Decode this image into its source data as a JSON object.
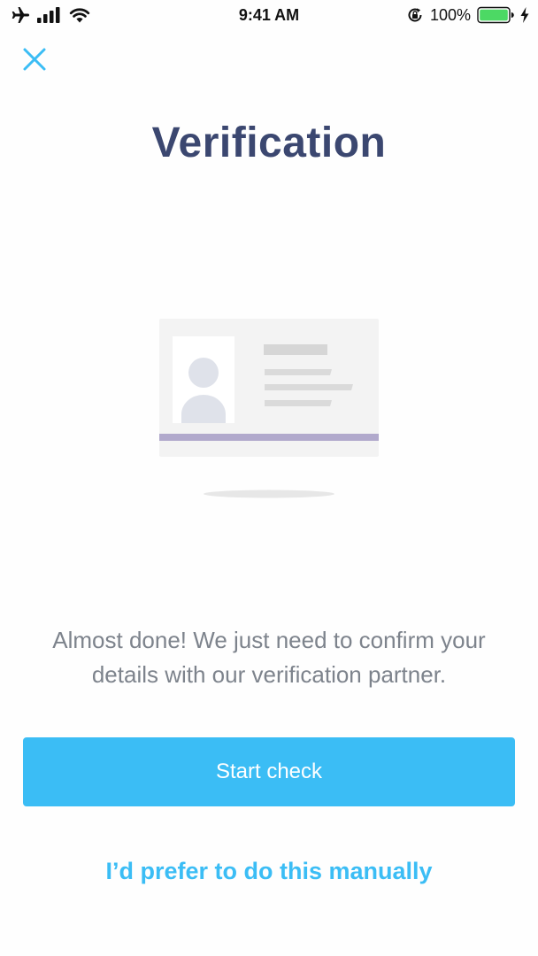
{
  "status_bar": {
    "time": "9:41 AM",
    "battery_percent": "100%",
    "icons": [
      "airplane-icon",
      "signal-icon",
      "wifi-icon",
      "orientation-lock-icon",
      "battery-icon",
      "charging-icon"
    ]
  },
  "header": {
    "close_icon": "close-icon",
    "title": "Verification"
  },
  "illustration": {
    "name": "id-card-illustration",
    "accent_color": "#b1a9cc"
  },
  "body": {
    "description": "Almost done! We just need to confirm your details with our verification partner."
  },
  "actions": {
    "primary_label": "Start check",
    "secondary_label": "I’d prefer to do this manually"
  },
  "colors": {
    "brand": "#3bbdf5",
    "title": "#3b4770",
    "text": "#7d838c",
    "battery": "#4cd964"
  }
}
